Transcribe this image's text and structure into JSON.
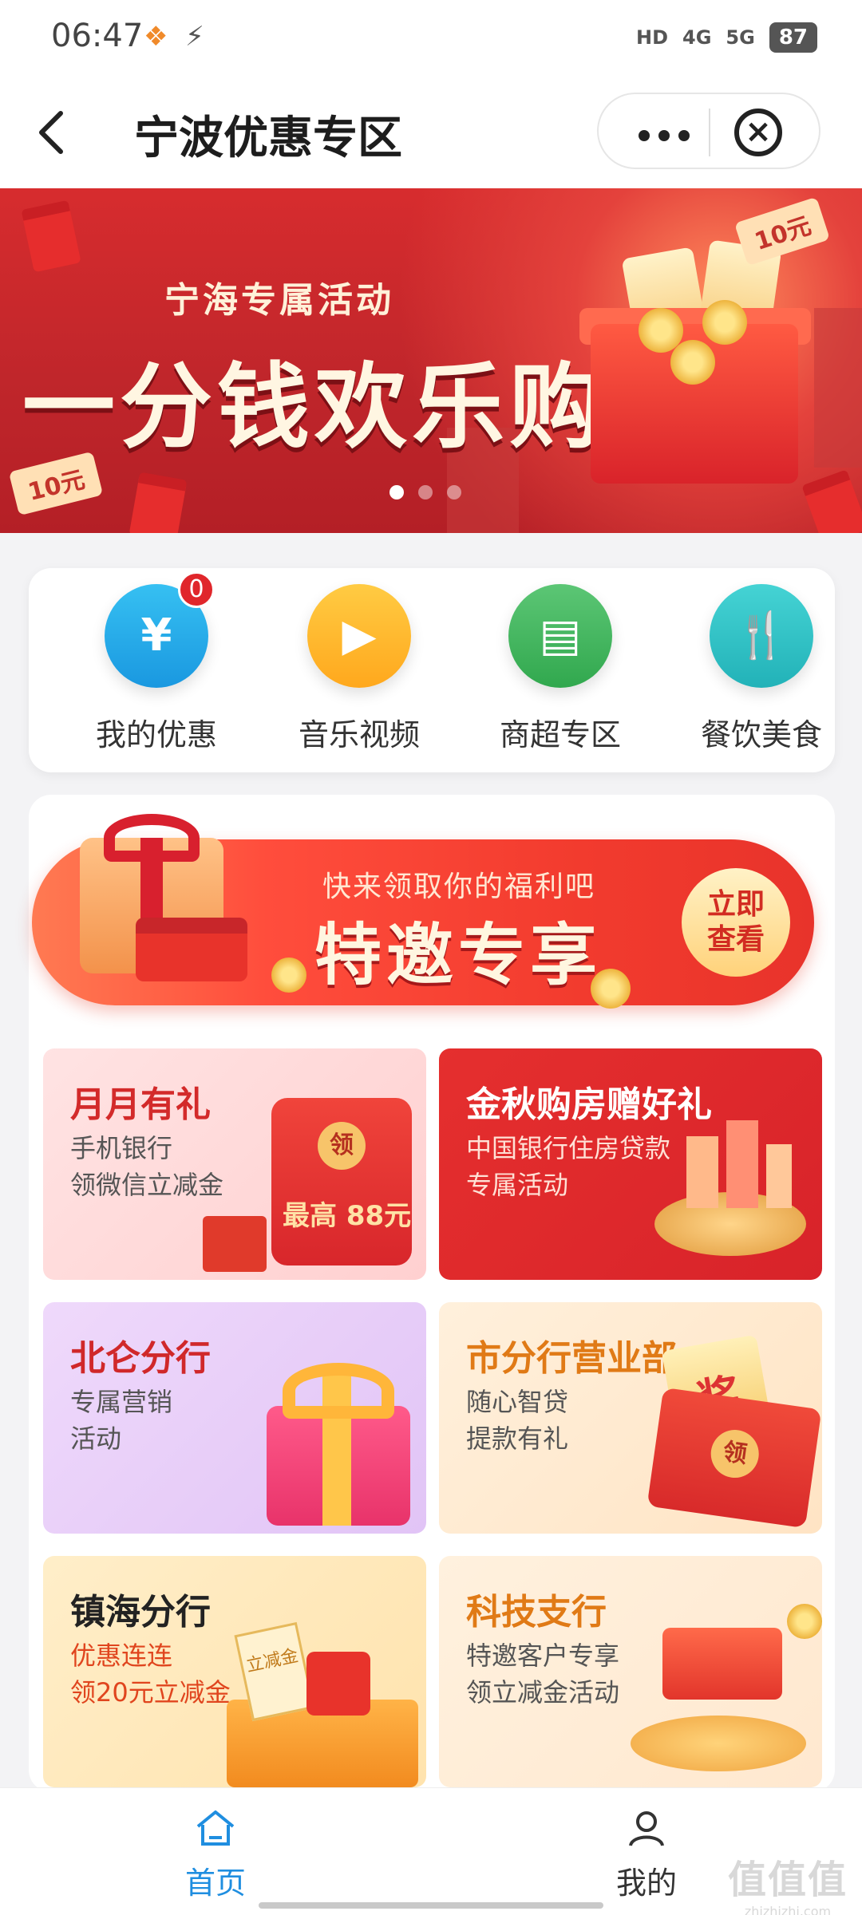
{
  "status_bar": {
    "time": "06:47",
    "network_1": "HD",
    "network_2": "4G",
    "network_3": "5G",
    "battery": "87"
  },
  "header": {
    "title": "宁波优惠专区"
  },
  "banner": {
    "subtitle": "宁海专属活动",
    "headline": "一分钱欢乐购",
    "tag": "10元",
    "slides": 3,
    "active_slide": 1
  },
  "categories": [
    {
      "label": "我的优惠",
      "icon": "ticket-yuan-icon",
      "color": "#2aaee8",
      "badge": "0"
    },
    {
      "label": "音乐视频",
      "icon": "play-icon",
      "color": "#ffb629"
    },
    {
      "label": "商超专区",
      "icon": "store-icon",
      "color": "#42b55f"
    },
    {
      "label": "餐饮美食",
      "icon": "fork-spoon-icon",
      "color": "#2fc2c6"
    }
  ],
  "invite": {
    "small_text": "快来领取你的福利吧",
    "big_text": "特邀专享",
    "button": "立即查看",
    "button_line1": "立即",
    "button_line2": "查看"
  },
  "tiles": [
    {
      "title": "月月有礼",
      "line1": "手机银行",
      "line2": "领微信立减金",
      "deco_text": "最高 88元",
      "deco_top": "领"
    },
    {
      "title": "金秋购房赠好礼",
      "line1": "中国银行住房贷款",
      "line2": "专属活动"
    },
    {
      "title": "北仑分行",
      "line1": "专属营销",
      "line2": "活动"
    },
    {
      "title": "市分行营业部",
      "line1": "随心智贷",
      "line2": "提款有礼",
      "deco_top": "领",
      "deco_text": "奖"
    },
    {
      "title": "镇海分行",
      "line1": "优惠连连",
      "line2": "领20元立减金",
      "deco_text": "立减金"
    },
    {
      "title": "科技支行",
      "line1": "特邀客户专享",
      "line2": "领立减金活动"
    }
  ],
  "bottom_nav": [
    {
      "label": "首页",
      "icon": "home-icon",
      "active": true
    },
    {
      "label": "我的",
      "icon": "user-icon",
      "active": false
    }
  ],
  "watermark": {
    "big": "值值值",
    "small": "zhizhizhi.com"
  },
  "colors": {
    "primary_blue": "#1f8ee0",
    "banner_red": "#c8262b"
  }
}
